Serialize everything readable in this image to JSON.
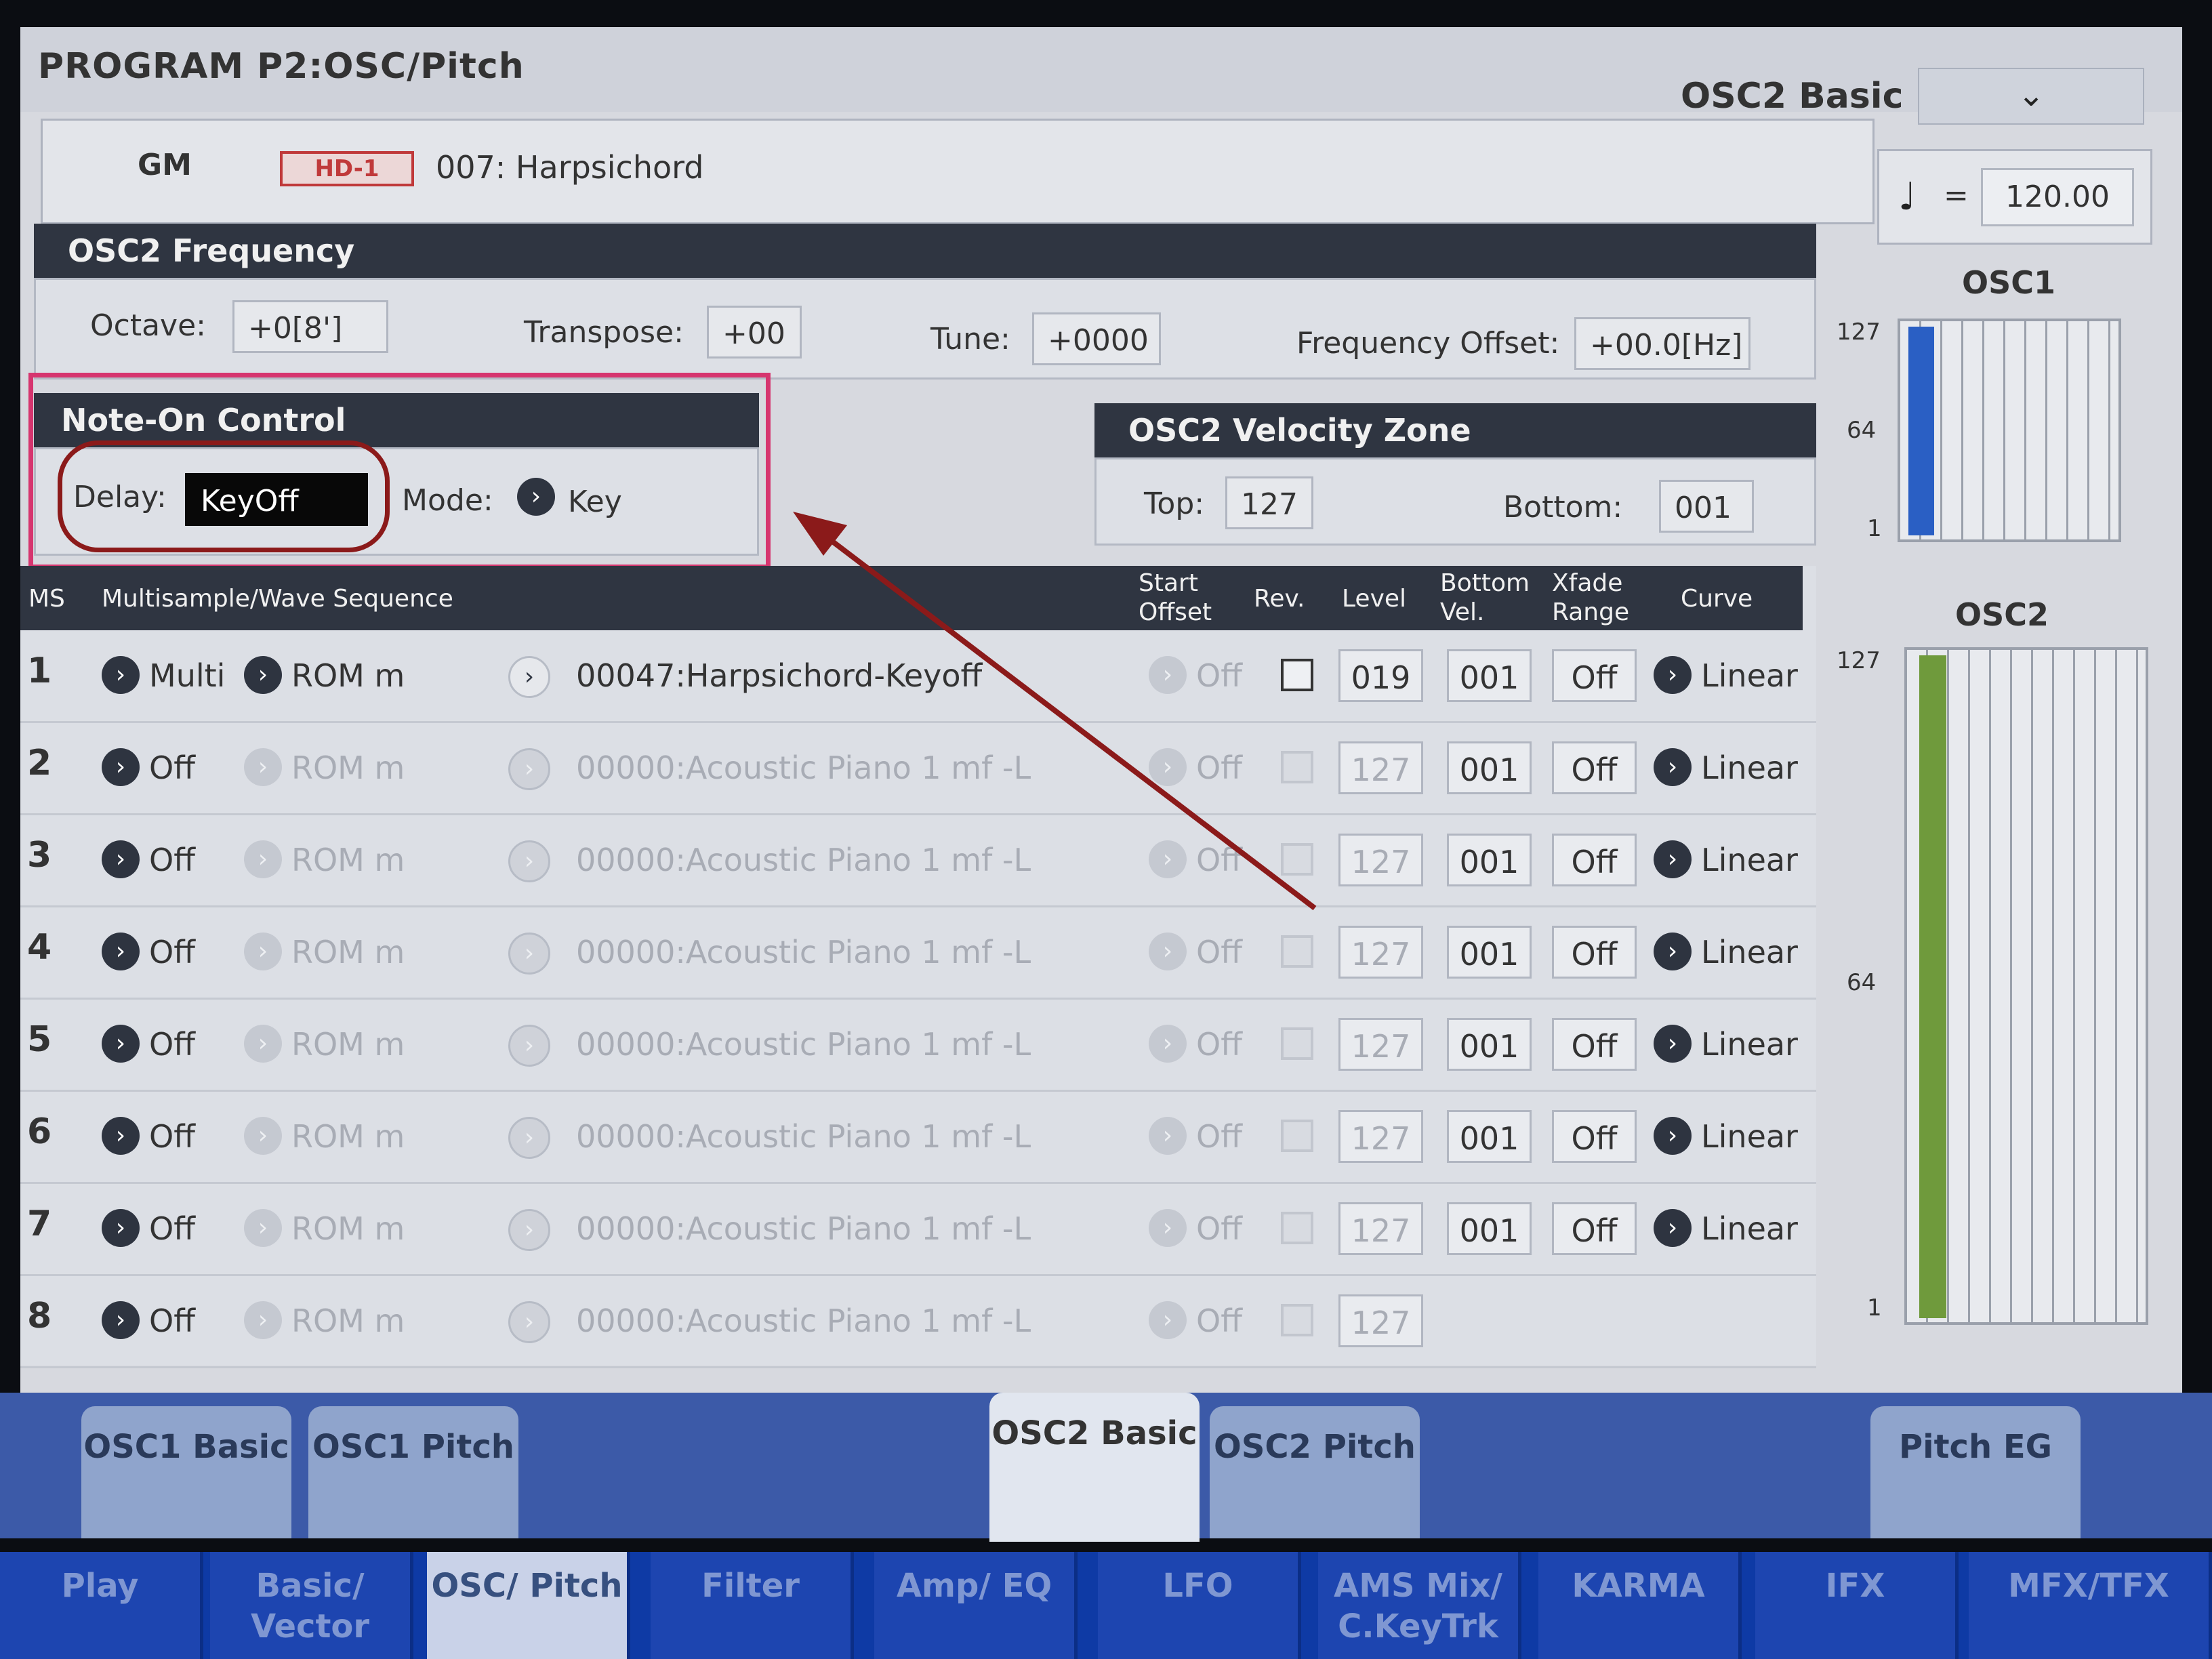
{
  "header": {
    "title": "PROGRAM P2:OSC/Pitch",
    "page_select": "OSC2 Basic"
  },
  "program": {
    "category": "GM",
    "bank": "HD-1",
    "name": "007: Harpsichord"
  },
  "tempo": {
    "symbol": "♩",
    "equals": "=",
    "value": "120.00"
  },
  "osc2_frequency": {
    "title": "OSC2 Frequency",
    "octave_label": "Octave:",
    "octave": "+0[8']",
    "transpose_label": "Transpose:",
    "transpose": "+00",
    "tune_label": "Tune:",
    "tune": "+0000",
    "offset_label": "Frequency Offset:",
    "offset": "+00.0[Hz]"
  },
  "note_on": {
    "title": "Note-On Control",
    "delay_label": "Delay:",
    "delay": "KeyOff",
    "mode_label": "Mode:",
    "mode": "Key"
  },
  "velocity_zone": {
    "title": "OSC2 Velocity Zone",
    "top_label": "Top:",
    "top": "127",
    "bottom_label": "Bottom:",
    "bottom": "001"
  },
  "table": {
    "headers": {
      "ms": "MS",
      "wave": "Multisample/Wave Sequence",
      "start1": "Start",
      "start2": "Offset",
      "rev": "Rev.",
      "level": "Level",
      "bv1": "Bottom",
      "bv2": "Vel.",
      "xf1": "Xfade",
      "xf2": "Range",
      "curve": "Curve"
    },
    "rows": [
      {
        "n": "1",
        "type": "Multi",
        "bank": "ROM m",
        "wave": "00047:Harpsichord-Keyoff",
        "offset": "Off",
        "level": "019",
        "bvel": "001",
        "xfade": "Off",
        "curve": "Linear"
      },
      {
        "n": "2",
        "type": "Off",
        "bank": "ROM m",
        "wave": "00000:Acoustic Piano 1 mf -L",
        "offset": "Off",
        "level": "127",
        "bvel": "001",
        "xfade": "Off",
        "curve": "Linear"
      },
      {
        "n": "3",
        "type": "Off",
        "bank": "ROM m",
        "wave": "00000:Acoustic Piano 1 mf -L",
        "offset": "Off",
        "level": "127",
        "bvel": "001",
        "xfade": "Off",
        "curve": "Linear"
      },
      {
        "n": "4",
        "type": "Off",
        "bank": "ROM m",
        "wave": "00000:Acoustic Piano 1 mf -L",
        "offset": "Off",
        "level": "127",
        "bvel": "001",
        "xfade": "Off",
        "curve": "Linear"
      },
      {
        "n": "5",
        "type": "Off",
        "bank": "ROM m",
        "wave": "00000:Acoustic Piano 1 mf -L",
        "offset": "Off",
        "level": "127",
        "bvel": "001",
        "xfade": "Off",
        "curve": "Linear"
      },
      {
        "n": "6",
        "type": "Off",
        "bank": "ROM m",
        "wave": "00000:Acoustic Piano 1 mf -L",
        "offset": "Off",
        "level": "127",
        "bvel": "001",
        "xfade": "Off",
        "curve": "Linear"
      },
      {
        "n": "7",
        "type": "Off",
        "bank": "ROM m",
        "wave": "00000:Acoustic Piano 1 mf -L",
        "offset": "Off",
        "level": "127",
        "bvel": "001",
        "xfade": "Off",
        "curve": "Linear"
      },
      {
        "n": "8",
        "type": "Off",
        "bank": "ROM m",
        "wave": "00000:Acoustic Piano 1 mf -L",
        "offset": "Off",
        "level": "127",
        "bvel": "",
        "xfade": "",
        "curve": ""
      }
    ]
  },
  "meters": {
    "osc1": {
      "title": "OSC1",
      "t127": "127",
      "t64": "64",
      "t1": "1"
    },
    "osc2": {
      "title": "OSC2",
      "t127": "127",
      "t64": "64",
      "t1": "1"
    }
  },
  "page_tabs": [
    "OSC1 Basic",
    "OSC1 Pitch",
    "OSC2 Basic",
    "OSC2 Pitch",
    "Pitch EG"
  ],
  "bottom_tabs": [
    "Play",
    "Basic/ Vector",
    "OSC/ Pitch",
    "Filter",
    "Amp/ EQ",
    "LFO",
    "AMS Mix/ C.KeyTrk",
    "KARMA",
    "IFX",
    "MFX/TFX"
  ],
  "colors": {
    "section_bar": "#2f3541",
    "highlight": "#d6356f",
    "annotation": "#8b1a1a",
    "tab_active": "#e1e6ef",
    "bottom_bar": "#0e3aa5",
    "osc1_bar": "#2a5fc4",
    "osc2_bar": "#6f9a3c"
  },
  "icons": {
    "dropdown": "chevron-down-icon",
    "select": "chevron-right-circle-icon",
    "tempo": "quarter-note-icon"
  }
}
